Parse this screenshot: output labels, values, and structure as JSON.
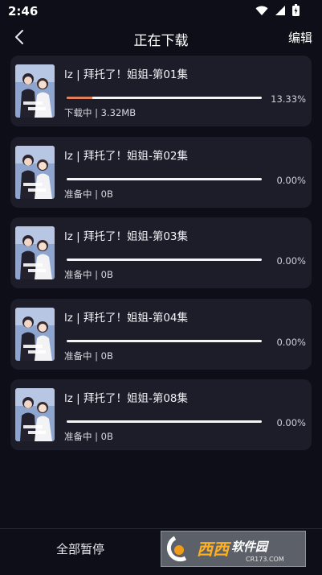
{
  "status_bar": {
    "time": "2:46"
  },
  "nav": {
    "title": "正在下载",
    "edit_label": "编辑"
  },
  "downloads": [
    {
      "title": "lz | 拜托了！姐姐-第01集",
      "progress_percent": 13.33,
      "percent_label": "13.33%",
      "status": "下载中 | 3.32MB"
    },
    {
      "title": "lz | 拜托了！姐姐-第02集",
      "progress_percent": 0,
      "percent_label": "0.00%",
      "status": "准备中 | 0B"
    },
    {
      "title": "lz | 拜托了！姐姐-第03集",
      "progress_percent": 0,
      "percent_label": "0.00%",
      "status": "准备中 | 0B"
    },
    {
      "title": "lz | 拜托了！姐姐-第04集",
      "progress_percent": 0,
      "percent_label": "0.00%",
      "status": "准备中 | 0B"
    },
    {
      "title": "lz | 拜托了！姐姐-第08集",
      "progress_percent": 0,
      "percent_label": "0.00%",
      "status": "准备中 | 0B"
    }
  ],
  "bottom_bar": {
    "pause_all_label": "全部暂停"
  },
  "watermark": {
    "text": "西西软件园",
    "sub": "CR173.COM"
  },
  "colors": {
    "background": "#0e0e18",
    "card": "#1d1d2a",
    "progress_fill": "#e0805a",
    "progress_track": "#f5f5f5"
  },
  "icons": {
    "back": "chevron-left-icon",
    "wifi": "wifi-icon",
    "signal": "signal-icon",
    "battery": "battery-icon"
  }
}
